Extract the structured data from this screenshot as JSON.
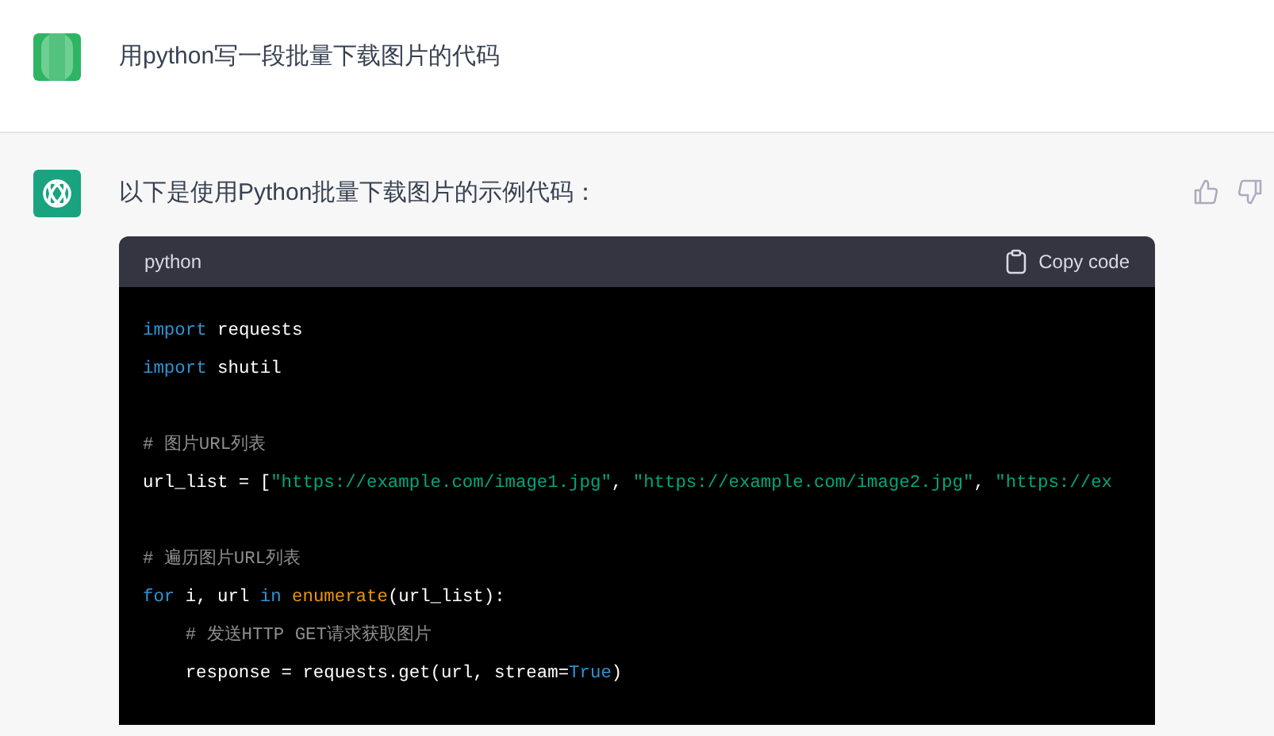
{
  "user_message": {
    "text": "用python写一段批量下载图片的代码"
  },
  "assistant_message": {
    "text": "以下是使用Python批量下载图片的示例代码：",
    "code_block": {
      "language": "python",
      "copy_label": "Copy code",
      "lines": [
        {
          "kind": "code",
          "tokens": [
            {
              "kind": "keyword",
              "text": "import"
            },
            {
              "kind": "plain",
              "text": " requests"
            }
          ]
        },
        {
          "kind": "code",
          "tokens": [
            {
              "kind": "keyword",
              "text": "import"
            },
            {
              "kind": "plain",
              "text": " shutil"
            }
          ]
        },
        {
          "kind": "blank"
        },
        {
          "kind": "code",
          "tokens": [
            {
              "kind": "comment",
              "text": "# 图片URL列表"
            }
          ]
        },
        {
          "kind": "code",
          "tokens": [
            {
              "kind": "plain",
              "text": "url_list = ["
            },
            {
              "kind": "string",
              "text": "\"https://example.com/image1.jpg\""
            },
            {
              "kind": "plain",
              "text": ", "
            },
            {
              "kind": "string",
              "text": "\"https://example.com/image2.jpg\""
            },
            {
              "kind": "plain",
              "text": ", "
            },
            {
              "kind": "string",
              "text": "\"https://ex"
            }
          ]
        },
        {
          "kind": "blank"
        },
        {
          "kind": "code",
          "tokens": [
            {
              "kind": "comment",
              "text": "# 遍历图片URL列表"
            }
          ]
        },
        {
          "kind": "code",
          "tokens": [
            {
              "kind": "keyword",
              "text": "for"
            },
            {
              "kind": "plain",
              "text": " i, url "
            },
            {
              "kind": "keyword",
              "text": "in"
            },
            {
              "kind": "builtin",
              "text": " enumerate"
            },
            {
              "kind": "plain",
              "text": "(url_list):"
            }
          ]
        },
        {
          "kind": "code",
          "indent": true,
          "tokens": [
            {
              "kind": "comment",
              "text": "# 发送HTTP GET请求获取图片"
            }
          ]
        },
        {
          "kind": "code",
          "indent": true,
          "tokens": [
            {
              "kind": "plain",
              "text": "response = requests.get(url, stream="
            },
            {
              "kind": "keyword",
              "text": "True"
            },
            {
              "kind": "plain",
              "text": ")"
            }
          ]
        }
      ]
    }
  }
}
